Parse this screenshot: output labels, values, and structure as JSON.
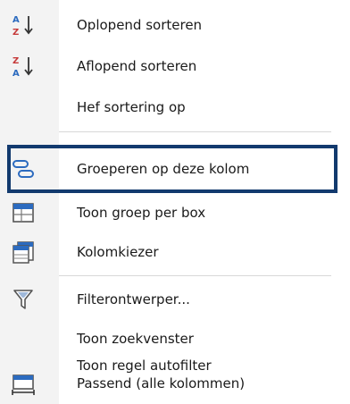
{
  "context_menu": {
    "items": [
      {
        "label": "Oplopend sorteren",
        "icon": "sort-ascending-icon"
      },
      {
        "label": "Aflopend sorteren",
        "icon": "sort-descending-icon"
      },
      {
        "label": "Hef sortering op",
        "icon": ""
      },
      {
        "label": "Groeperen op deze kolom",
        "icon": "group-by-column-icon",
        "highlighted": true
      },
      {
        "label": "Toon groep per box",
        "icon": "group-box-icon"
      },
      {
        "label": "Kolomkiezer",
        "icon": "column-chooser-icon"
      },
      {
        "label": "Filterontwerper...",
        "icon": "filter-icon"
      },
      {
        "label": "Toon zoekvenster",
        "icon": ""
      },
      {
        "label": "Toon regel autofilter",
        "icon": ""
      },
      {
        "label": "Passend (alle kolommen)",
        "icon": "best-fit-icon"
      }
    ],
    "colors": {
      "highlight_border": "#123a6e",
      "icon_blue": "#2c6bbf",
      "icon_red": "#c63a3a"
    }
  }
}
